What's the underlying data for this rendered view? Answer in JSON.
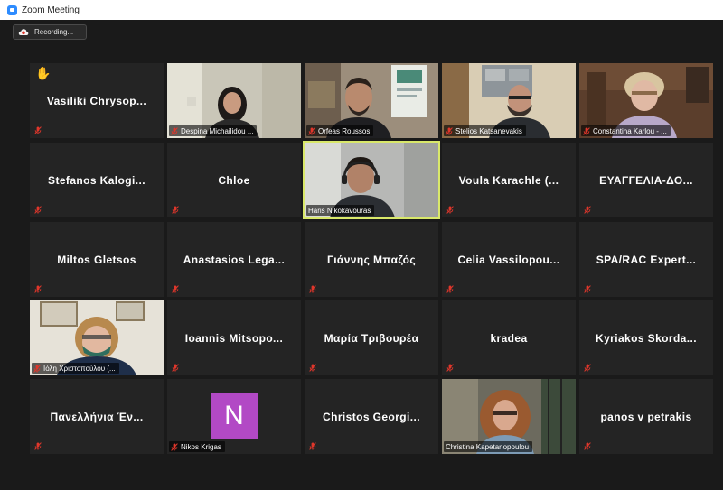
{
  "window": {
    "title": "Zoom Meeting"
  },
  "recording": {
    "label": "Recording..."
  },
  "colors": {
    "active_speaker": "#d9e86a",
    "muted": "#e0362b",
    "avatar_N": "#b249c5"
  },
  "participants": [
    {
      "name": "Vasiliki Chrysop...",
      "video": false,
      "raised_hand": true
    },
    {
      "name": "Despina Michailidou ...",
      "video": true
    },
    {
      "name": "Orfeas Roussos",
      "video": true
    },
    {
      "name": "Stelios Katsanevakis",
      "video": true
    },
    {
      "name": "Constantina Karlou - ...",
      "video": true
    },
    {
      "name": "Stefanos Kalogi...",
      "video": false
    },
    {
      "name": "Chloe",
      "video": false
    },
    {
      "name": "Haris Nikokavouras",
      "video": true,
      "active_speaker": true
    },
    {
      "name": "Voula Karachle (...",
      "video": false
    },
    {
      "name": "ΕΥΑΓΓΕΛΙΑ-ΔΟ...",
      "video": false
    },
    {
      "name": "Miltos Gletsos",
      "video": false
    },
    {
      "name": "Anastasios Lega...",
      "video": false
    },
    {
      "name": "Γιάννης Μπαζός",
      "video": false
    },
    {
      "name": "Celia Vassilopou...",
      "video": false
    },
    {
      "name": "SPA/RAC Expert...",
      "video": false
    },
    {
      "name": "Ιόλη Χριστοπούλου (...",
      "video": true
    },
    {
      "name": "Ioannis Mitsopo...",
      "video": false
    },
    {
      "name": "Μαρία Τριβουρέα",
      "video": false
    },
    {
      "name": "kradea",
      "video": false
    },
    {
      "name": "Kyriakos Skorda...",
      "video": false
    },
    {
      "name": "Πανελλήνια Έν...",
      "video": false
    },
    {
      "name": "Nikos Krigas",
      "video": false,
      "avatar_letter": "N"
    },
    {
      "name": "Christos Georgi...",
      "video": false
    },
    {
      "name": "Christina Kapetanopoulou",
      "video": true
    },
    {
      "name": "panos v petrakis",
      "video": false
    }
  ]
}
